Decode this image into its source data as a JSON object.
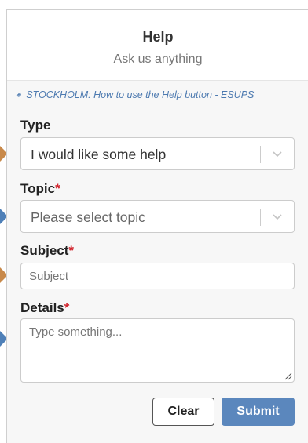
{
  "panel": {
    "title": "Help",
    "subtitle": "Ask us anything"
  },
  "help_link": {
    "text": "STOCKHOLM: How to use the Help button - ESUPS",
    "icon": "link-icon"
  },
  "type_field": {
    "label": "Type",
    "value": "I would like some help"
  },
  "topic_field": {
    "label": "Topic",
    "required_mark": "*",
    "placeholder": "Please select topic"
  },
  "subject_field": {
    "label": "Subject",
    "required_mark": "*",
    "placeholder": "Subject"
  },
  "details_field": {
    "label": "Details",
    "required_mark": "*",
    "placeholder": "Type something..."
  },
  "buttons": {
    "clear_label": "Clear",
    "submit_label": "Submit"
  },
  "colors": {
    "accent": "#5b87bd",
    "required": "#d2262f",
    "link": "#4d7ab0",
    "marker_orange": "#c8894a",
    "marker_blue": "#4f80b8"
  }
}
